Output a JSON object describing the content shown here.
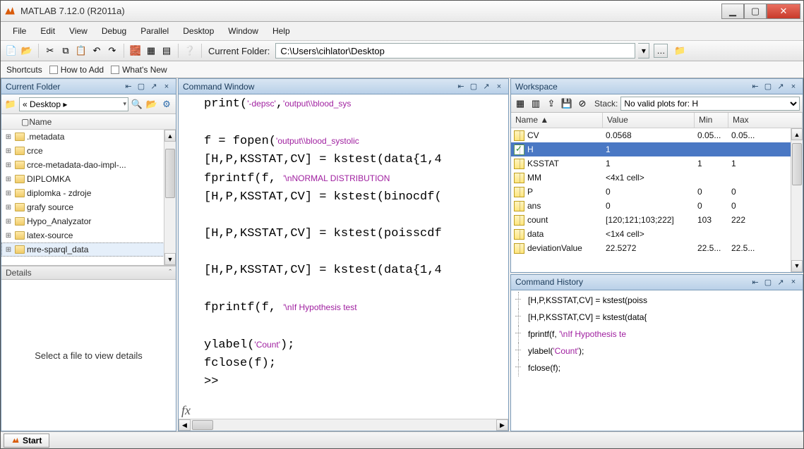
{
  "window": {
    "title": "MATLAB 7.12.0 (R2011a)"
  },
  "menu": [
    "File",
    "Edit",
    "View",
    "Debug",
    "Parallel",
    "Desktop",
    "Window",
    "Help"
  ],
  "toolbar": {
    "current_folder_label": "Current Folder:",
    "current_folder_value": "C:\\Users\\cihlator\\Desktop"
  },
  "shortcuts": {
    "label": "Shortcuts",
    "how_to_add": "How to Add",
    "whats_new": "What's New"
  },
  "currentFolderPane": {
    "title": "Current Folder",
    "path_display": "« Desktop ▸",
    "name_header": "Name",
    "items": [
      ".metadata",
      "crce",
      "crce-metadata-dao-impl-...",
      "DIPLOMKA",
      "diplomka - zdroje",
      "grafy source",
      "Hypo_Analyzator",
      "latex-source",
      "mre-sparql_data"
    ],
    "details_label": "Details",
    "details_empty": "Select a file to view details"
  },
  "commandWindow": {
    "title": "Command Window",
    "lines": [
      {
        "pre": "print(",
        "str": "'-depsc'",
        "mid": ",",
        "str2": "'output\\\\blood_sys",
        "post": ""
      },
      {
        "pre": "",
        "str": "",
        "mid": "",
        "str2": "",
        "post": ""
      },
      {
        "pre": "f = fopen(",
        "str": "'output\\\\blood_systolic",
        "mid": "",
        "str2": "",
        "post": ""
      },
      {
        "pre": "[H,P,KSSTAT,CV] = kstest(data{1,4",
        "str": "",
        "mid": "",
        "str2": "",
        "post": ""
      },
      {
        "pre": "fprintf(f, ",
        "str": "'\\nNORMAL DISTRIBUTION",
        "mid": "",
        "str2": "",
        "post": ""
      },
      {
        "pre": "[H,P,KSSTAT,CV] = kstest(binocdf(",
        "str": "",
        "mid": "",
        "str2": "",
        "post": ""
      },
      {
        "pre": "",
        "str": "",
        "mid": "",
        "str2": "",
        "post": ""
      },
      {
        "pre": "[H,P,KSSTAT,CV] = kstest(poisscdf",
        "str": "",
        "mid": "",
        "str2": "",
        "post": ""
      },
      {
        "pre": "",
        "str": "",
        "mid": "",
        "str2": "",
        "post": ""
      },
      {
        "pre": "[H,P,KSSTAT,CV] = kstest(data{1,4",
        "str": "",
        "mid": "",
        "str2": "",
        "post": ""
      },
      {
        "pre": "",
        "str": "",
        "mid": "",
        "str2": "",
        "post": ""
      },
      {
        "pre": "fprintf(f, ",
        "str": "'\\nIf Hypothesis test ",
        "mid": "",
        "str2": "",
        "post": ""
      },
      {
        "pre": "",
        "str": "",
        "mid": "",
        "str2": "",
        "post": ""
      },
      {
        "pre": "ylabel(",
        "str": "'Count'",
        "mid": ");",
        "str2": "",
        "post": ""
      },
      {
        "pre": "fclose(f);",
        "str": "",
        "mid": "",
        "str2": "",
        "post": ""
      },
      {
        "pre": ">> ",
        "str": "",
        "mid": "",
        "str2": "",
        "post": ""
      }
    ]
  },
  "workspace": {
    "title": "Workspace",
    "stack_label": "Stack:",
    "plot_select": "No valid plots for: H",
    "headers": {
      "name": "Name ▲",
      "value": "Value",
      "min": "Min",
      "max": "Max"
    },
    "rows": [
      {
        "icon": "num",
        "name": "CV",
        "value": "0.0568",
        "min": "0.05...",
        "max": "0.05..."
      },
      {
        "icon": "chk",
        "name": "H",
        "value": "1",
        "min": "",
        "max": "",
        "sel": true
      },
      {
        "icon": "num",
        "name": "KSSTAT",
        "value": "1",
        "min": "1",
        "max": "1"
      },
      {
        "icon": "cell",
        "name": "MM",
        "value": "<4x1 cell>",
        "min": "",
        "max": ""
      },
      {
        "icon": "num",
        "name": "P",
        "value": "0",
        "min": "0",
        "max": "0"
      },
      {
        "icon": "num",
        "name": "ans",
        "value": "0",
        "min": "0",
        "max": "0"
      },
      {
        "icon": "num",
        "name": "count",
        "value": "[120;121;103;222]",
        "min": "103",
        "max": "222"
      },
      {
        "icon": "cell",
        "name": "data",
        "value": "<1x4 cell>",
        "min": "",
        "max": ""
      },
      {
        "icon": "num",
        "name": "deviationValue",
        "value": "22.5272",
        "min": "22.5...",
        "max": "22.5..."
      }
    ]
  },
  "commandHistory": {
    "title": "Command History",
    "lines": [
      "[H,P,KSSTAT,CV] = kstest(poiss",
      "[H,P,KSSTAT,CV] = kstest(data{",
      "fprintf(f, '\\nIf Hypothesis te",
      "ylabel('Count');",
      "fclose(f);"
    ]
  },
  "start": {
    "label": "Start"
  }
}
